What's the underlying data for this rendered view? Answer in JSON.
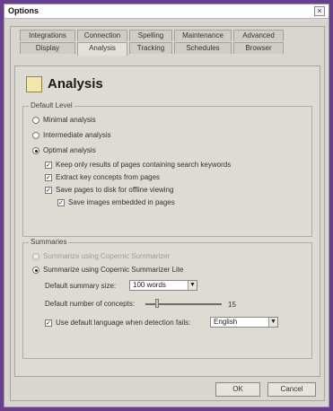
{
  "window": {
    "title": "Options"
  },
  "title_bar": {
    "close_glyph": "×"
  },
  "tabs": {
    "top": [
      "Integrations",
      "Connection",
      "Spelling",
      "Maintenance",
      "Advanced"
    ],
    "bottom": [
      "Display",
      "Analysis",
      "Tracking",
      "Schedules",
      "Browser"
    ],
    "active": "Analysis"
  },
  "panel": {
    "title": "Analysis",
    "default_level": {
      "label": "Default Level",
      "options": [
        {
          "label": "Minimal analysis",
          "selected": false
        },
        {
          "label": "Intermediate analysis",
          "selected": false
        },
        {
          "label": "Optimal analysis",
          "selected": true
        }
      ],
      "checks": [
        {
          "label": "Keep only results of pages containing search keywords",
          "checked": true
        },
        {
          "label": "Extract key concepts from pages",
          "checked": true
        },
        {
          "label": "Save pages to disk for offline viewing",
          "checked": true
        },
        {
          "label": "Save images embedded in pages",
          "checked": true
        }
      ]
    },
    "summaries": {
      "label": "Summaries",
      "options": [
        {
          "label": "Summarize using Copernic Summarizer",
          "selected": false,
          "disabled": true
        },
        {
          "label": "Summarize using Copernic Summarizer Lite",
          "selected": true,
          "disabled": false
        }
      ],
      "default_summary_size": {
        "label": "Default summary size:",
        "value": "100 words"
      },
      "default_number_of_concepts": {
        "label": "Default number of concepts:",
        "value": "15",
        "level": 0.15
      },
      "use_default_language": {
        "label": "Use default language when detection fails:",
        "checked": true,
        "value": "English"
      }
    }
  },
  "buttons": {
    "ok": "OK",
    "cancel": "Cancel"
  }
}
